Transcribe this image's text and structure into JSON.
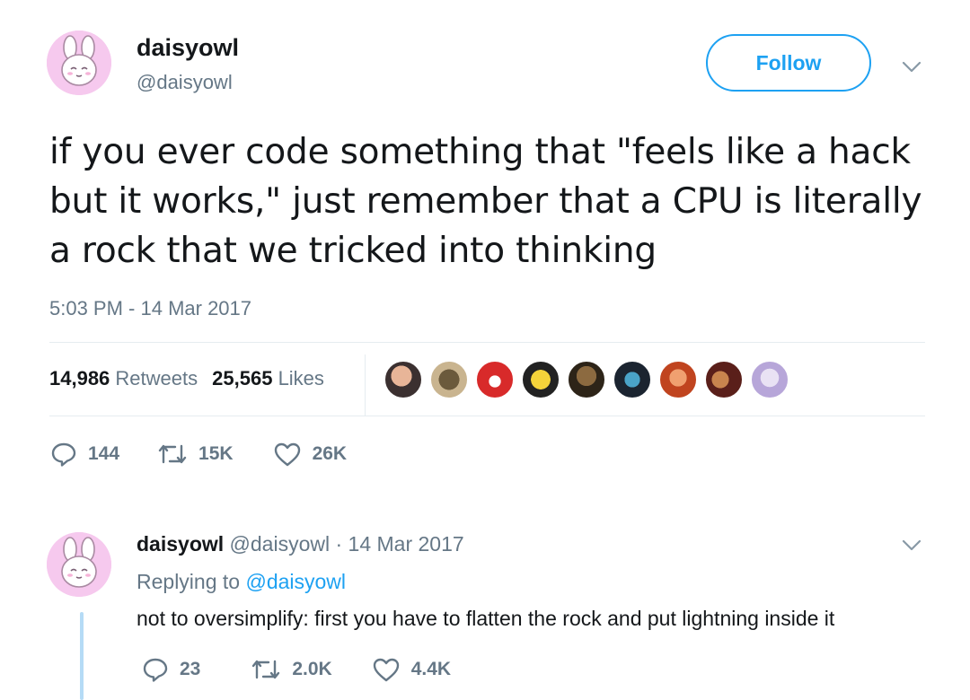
{
  "tweet": {
    "display_name": "daisyowl",
    "handle": "@daisyowl",
    "follow_label": "Follow",
    "text": "if you ever code something that \"feels like a hack but it works,\" just remember that a CPU is literally a rock that we tricked into thinking",
    "timestamp": "5:03 PM - 14 Mar 2017",
    "retweets_count": "14,986",
    "retweets_label": "Retweets",
    "likes_count": "25,565",
    "likes_label": "Likes",
    "liker_count_shown": 9,
    "actions": {
      "replies": "144",
      "retweets": "15K",
      "likes": "26K"
    }
  },
  "reply": {
    "display_name": "daisyowl",
    "meta": "@daisyowl · 14 Mar 2017",
    "replying_prefix": "Replying to",
    "replying_to": "@daisyowl",
    "text": "not to oversimplify: first you have to flatten the rock and put lightning inside it",
    "actions": {
      "replies": "23",
      "retweets": "2.0K",
      "likes": "4.4K"
    }
  },
  "colors": {
    "accent": "#1da1f2",
    "secondary_text": "#657786",
    "avatar_bg": "#f6c9ee",
    "thread_line": "#b5dbf6"
  },
  "icons": {
    "reply": "reply-icon",
    "retweet": "retweet-icon",
    "like": "heart-icon",
    "menu": "chevron-down-icon"
  }
}
